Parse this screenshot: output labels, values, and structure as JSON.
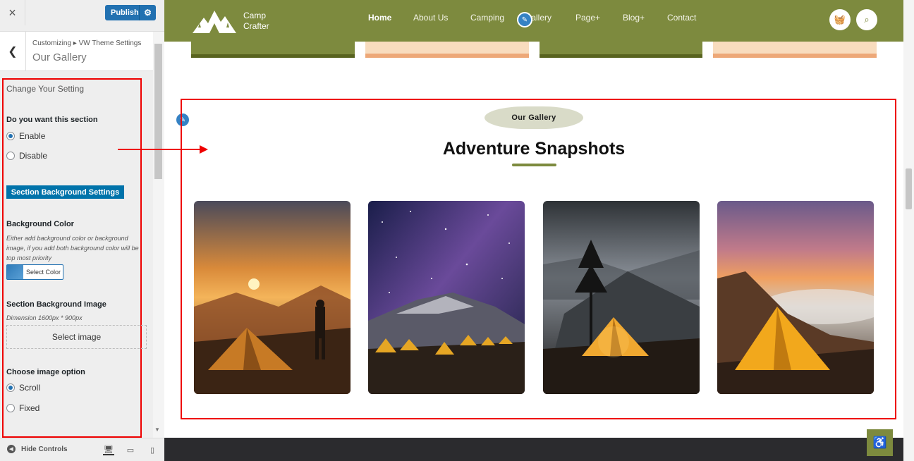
{
  "topbar": {
    "close_icon": "×",
    "publish_label": "Publish"
  },
  "header": {
    "breadcrumb": "Customizing ▸ VW Theme Settings",
    "title": "Our Gallery"
  },
  "panel": {
    "heading": "Change Your Setting",
    "enable_question": "Do you want this section",
    "enable_label": "Enable",
    "disable_label": "Disable",
    "section_bg_button": "Section Background Settings",
    "bg_color_label": "Background Color",
    "bg_color_desc": "Either add background color or background image, if you add both background color will be top most priority",
    "select_color": "Select Color",
    "bg_image_label": "Section Background Image",
    "bg_image_dim": "Dimension 1600px * 900px",
    "select_image": "Select image",
    "image_option_label": "Choose image option",
    "scroll_label": "Scroll",
    "fixed_label": "Fixed",
    "selected_visibility": "Enable",
    "selected_image_option": "Scroll"
  },
  "bottom": {
    "hide_controls": "Hide Controls"
  },
  "site": {
    "logo_line1": "Camp",
    "logo_line2": "Crafter",
    "nav": [
      "Home",
      "About Us",
      "Camping",
      "Gallery",
      "Page+",
      "Blog+",
      "Contact"
    ],
    "active_nav": "Home",
    "gallery_badge": "Our Gallery",
    "gallery_title": "Adventure Snapshots",
    "photos": [
      "sunset-hiker-tent",
      "starry-night-camp",
      "mountain-tree-tent",
      "sunrise-cloud-tent"
    ]
  },
  "colors": {
    "brand_green": "#7d8a3e",
    "wp_blue": "#2271b1",
    "highlight_red": "#ee0000",
    "peach": "#f8dcbe"
  }
}
